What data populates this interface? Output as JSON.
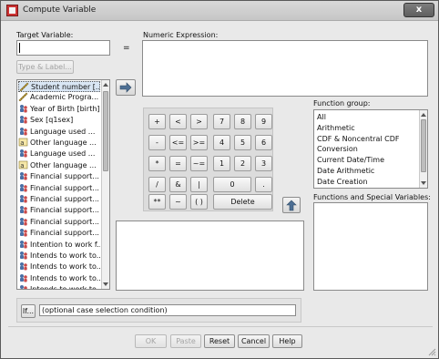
{
  "window": {
    "title": "Compute Variable",
    "close_symbol": "x"
  },
  "target": {
    "label": "Target Variable:",
    "equals": "=",
    "type_label_button": "Type & Label..."
  },
  "numeric_expression": {
    "label": "Numeric Expression:"
  },
  "variables": [
    {
      "label": "Student number [...",
      "icon": "scale-ruler-icon"
    },
    {
      "label": "Academic Progra...",
      "icon": "scale-ruler-icon"
    },
    {
      "label": "Year of Birth [birth]",
      "icon": "nominal-people-icon"
    },
    {
      "label": "Sex [q1sex]",
      "icon": "nominal-people-icon"
    },
    {
      "label": "Language used ...",
      "icon": "nominal-people-icon"
    },
    {
      "label": "Other language ...",
      "icon": "string-icon"
    },
    {
      "label": "Language used ...",
      "icon": "nominal-people-icon"
    },
    {
      "label": "Other language ...",
      "icon": "string-icon"
    },
    {
      "label": "Financial support...",
      "icon": "nominal-people-icon"
    },
    {
      "label": "Financial support...",
      "icon": "nominal-people-icon"
    },
    {
      "label": "Financial support...",
      "icon": "nominal-people-icon"
    },
    {
      "label": "Financial support...",
      "icon": "nominal-people-icon"
    },
    {
      "label": "Financial support...",
      "icon": "nominal-people-icon"
    },
    {
      "label": "Financial support...",
      "icon": "nominal-people-icon"
    },
    {
      "label": "Intention to work f...",
      "icon": "nominal-people-icon"
    },
    {
      "label": "Intends to work to...",
      "icon": "nominal-people-icon"
    },
    {
      "label": "Intends to work to...",
      "icon": "nominal-people-icon"
    },
    {
      "label": "Intends to work to...",
      "icon": "nominal-people-icon"
    },
    {
      "label": "Intends to work to...",
      "icon": "nominal-people-icon"
    }
  ],
  "keypad": {
    "row1": [
      "+",
      "<",
      ">",
      "7",
      "8",
      "9"
    ],
    "row2": [
      "-",
      "<=",
      ">=",
      "4",
      "5",
      "6"
    ],
    "row3": [
      "*",
      "=",
      "~=",
      "1",
      "2",
      "3"
    ],
    "row4": [
      "/",
      "&",
      "|",
      "0",
      "."
    ],
    "row5": [
      "**",
      "~",
      "( )",
      "Delete"
    ]
  },
  "function_group": {
    "label": "Function group:",
    "items": [
      "All",
      "Arithmetic",
      "CDF & Noncentral CDF",
      "Conversion",
      "Current Date/Time",
      "Date Arithmetic",
      "Date Creation"
    ]
  },
  "functions_label": "Functions and Special Variables:",
  "if_condition": {
    "button": "If...",
    "text": "(optional case selection condition)"
  },
  "buttons": {
    "ok": "OK",
    "paste": "Paste",
    "reset": "Reset",
    "cancel": "Cancel",
    "help": "Help"
  }
}
